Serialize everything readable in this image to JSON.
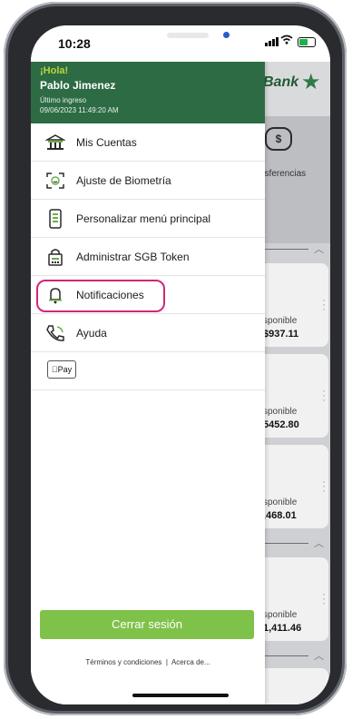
{
  "status_bar": {
    "time": "10:28"
  },
  "background_app": {
    "bank_name": "Bank",
    "transfer_label": "nsferencias",
    "cards": [
      {
        "label": "sponible",
        "amount": "$937.11"
      },
      {
        "label": "sponible",
        "amount": "5452.80"
      },
      {
        "label": "sponible",
        "amount": ",468.01"
      },
      {
        "label": "sponible",
        "amount": "1,411.46"
      }
    ]
  },
  "drawer": {
    "greeting": "¡Hola!",
    "user_name": "Pablo Jimenez",
    "last_login_label": "Último ingreso",
    "last_login_date": "09/06/2023 11:49:20 AM",
    "menu": [
      {
        "label": "Mis Cuentas",
        "icon": "bank-icon"
      },
      {
        "label": "Ajuste de Biometría",
        "icon": "face-scan-icon"
      },
      {
        "label": "Personalizar menú principal",
        "icon": "phone-menu-icon"
      },
      {
        "label": "Administrar SGB Token",
        "icon": "token-icon"
      },
      {
        "label": "Notificaciones",
        "icon": "bell-icon"
      },
      {
        "label": "Ayuda",
        "icon": "phone-icon"
      }
    ],
    "apple_pay_label": "Pay",
    "logout_label": "Cerrar sesión",
    "footer_links": {
      "terms": "Términos y condiciones",
      "separator": "|",
      "about": "Acerca de..."
    }
  },
  "colors": {
    "brand_green": "#2d6b44",
    "accent_lime": "#b8d63a",
    "button_green": "#7fc24a",
    "highlight_pink": "#d1267a"
  }
}
